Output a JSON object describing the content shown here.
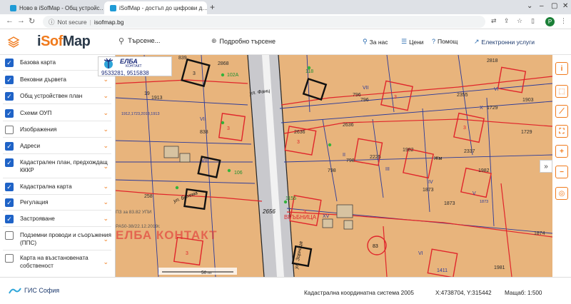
{
  "browser": {
    "tabs": [
      {
        "title": "Ново в iSofMap - Общ устройс…"
      },
      {
        "title": "iSofMap - достъп до цифрови д…"
      }
    ],
    "address": {
      "security": "Not secure",
      "url": "isofmap.bg"
    },
    "profile_initial": "P"
  },
  "header": {
    "logo_i": "i",
    "logo_sof": "Sof",
    "logo_map": "Map",
    "search_placeholder": "Търсене...",
    "advanced_search": "Подробно търсене",
    "nav": {
      "about": "За нас",
      "prices": "Цени",
      "help": "Помощ",
      "services": "Електронни услуги"
    }
  },
  "ad": {
    "brand": "ЕЛБА",
    "sub": "КОНТАКТ",
    "phone": "9533281, 9515838"
  },
  "layers": [
    {
      "label": "Базова карта",
      "checked": true
    },
    {
      "label": "Вековни дървета",
      "checked": true
    },
    {
      "label": "Общ устройствен план",
      "checked": true
    },
    {
      "label": "Схеми ОУП",
      "checked": true
    },
    {
      "label": "Изображения",
      "checked": false
    },
    {
      "label": "Адреси",
      "checked": true
    },
    {
      "label": "Кадастрален план, предхождащ КККР",
      "checked": true
    },
    {
      "label": "Кадастрална карта",
      "checked": true
    },
    {
      "label": "Регулация",
      "checked": true
    },
    {
      "label": "Застрояване",
      "checked": true
    },
    {
      "label": "Подземни проводи и съоръжения (ППС)",
      "checked": false
    },
    {
      "label": "Карта на възстановената собственост",
      "checked": false
    }
  ],
  "map": {
    "labels": {
      "n2868": "2868",
      "n839": "839",
      "n102a": "102А",
      "n19": "19",
      "n1913": "1913",
      "n1912": "1912,1723,2018,1913",
      "nVII1": "VII",
      "n838": "838",
      "nVIII": "VIII",
      "n106": "106",
      "n118": "118",
      "nVII2": "VII",
      "n796a": "796",
      "n796b": "796",
      "n2355": "2355",
      "n2818": "2818",
      "n1729a": "1729",
      "n1729b": "1729",
      "nX": "X",
      "nVI": "VI",
      "n1903": "1903",
      "n2636a": "2636",
      "n2636b": "2636",
      "n798a": "798",
      "n798b": "798",
      "n2225": "2225",
      "n1982a": "1982",
      "n1982b": "1982",
      "nII": "II",
      "nIII": "III",
      "nIV": "IV",
      "nV": "V",
      "n1873a": "1873",
      "n1873b": "1873",
      "n1873c": "1873",
      "n2337": "2337",
      "nZh": "Жм",
      "n83": "83",
      "nXV": "XV",
      "n1411": "1411",
      "n1874": "1874",
      "n1981": "1981",
      "street1": "ул. Фанц",
      "street2": "ул. Бохема",
      "street3": "ул. Зорница",
      "varbnitsa": "ВРЪБНИЦА",
      "n2656": "2656",
      "n1155": "1155",
      "n258": "258",
      "watermark": "ЕЛБА КОНТАКТ",
      "pz": "ПЗ за 83.82 УПИ",
      "ra": "РА50-38/22.12.2019г.",
      "scale_bar": "50 m",
      "n3": "3"
    }
  },
  "footer": {
    "gis_logo": "ГИС София",
    "coord_system": "Кадастрална координатна система 2005",
    "coords": "X:4738704, Y:315442",
    "scale": "Мащаб: 1:500"
  },
  "colors": {
    "accent": "#f07a1c",
    "checkbox": "#1f63c7",
    "map_bg": "#e8b47c",
    "parcel_red": "#e0252b",
    "reg_blue": "#2b3a9a"
  }
}
